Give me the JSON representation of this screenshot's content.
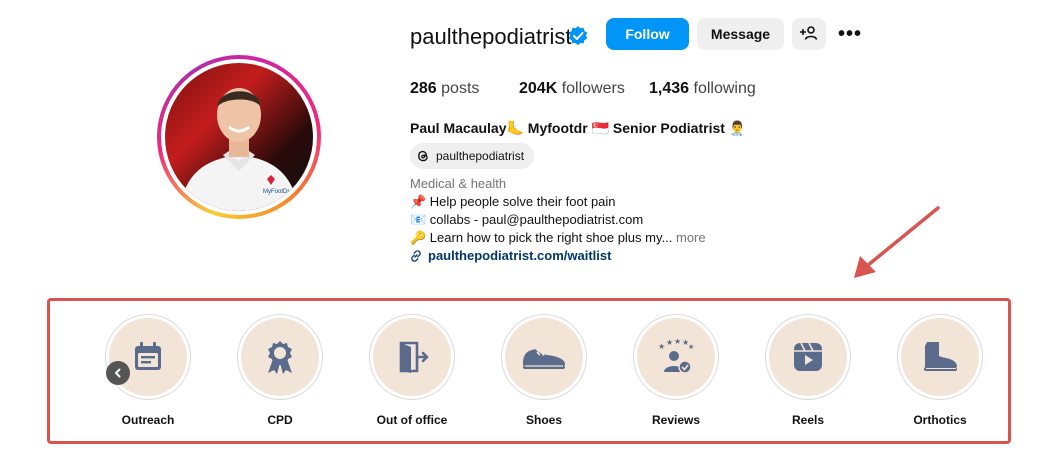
{
  "profile": {
    "username": "paulthepodiatrist",
    "follow_label": "Follow",
    "message_label": "Message",
    "more_label": "•••"
  },
  "stats": {
    "posts_count": "286",
    "posts_label": "posts",
    "followers_count": "204K",
    "followers_label": "followers",
    "following_count": "1,436",
    "following_label": "following"
  },
  "bio": {
    "full_name": "Paul Macaulay🦶 Myfootdr 🇸🇬 Senior Podiatrist 👨‍⚕️",
    "threads_handle": "paulthepodiatrist",
    "category": "Medical & health",
    "line1": "📌 Help people solve their foot pain",
    "line2": "📧 collabs - paul@paulthepodiatrist.com",
    "line3": "🔑 Learn how to pick the right shoe plus my...",
    "more_label": "more",
    "link": "paulthepodiatrist.com/waitlist"
  },
  "highlights": [
    {
      "label": "Outreach",
      "icon": "calendar-icon"
    },
    {
      "label": "CPD",
      "icon": "award-ribbon-icon"
    },
    {
      "label": "Out of office",
      "icon": "door-exit-icon"
    },
    {
      "label": "Shoes",
      "icon": "sneaker-icon"
    },
    {
      "label": "Reviews",
      "icon": "star-rating-icon"
    },
    {
      "label": "Reels",
      "icon": "reels-icon"
    },
    {
      "label": "Orthotics",
      "icon": "boot-icon"
    }
  ],
  "colors": {
    "follow": "#0095f6",
    "verified": "#0095f6",
    "annotation": "#d9534f",
    "highlight_bg": "#f3e4d8",
    "highlight_icon": "#5b6b8c"
  }
}
